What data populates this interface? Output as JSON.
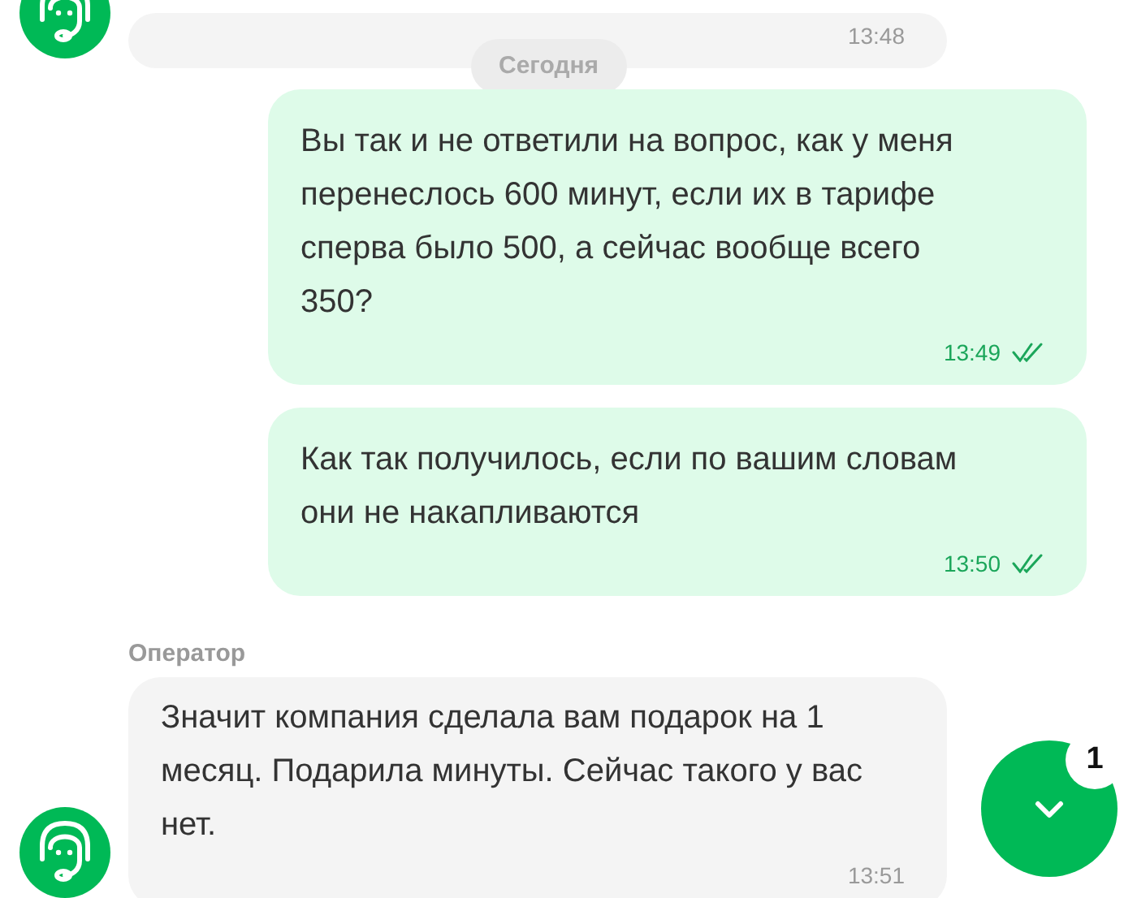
{
  "messages": [
    {
      "kind": "incoming",
      "time": "13:48"
    },
    {
      "kind": "date",
      "text": "Сегодня"
    },
    {
      "kind": "outgoing",
      "text": "Вы так и не ответили на вопрос, как у меня перенеслось 600 минут, если их в тарифе сперва было 500, а сейчас вообще всего 350?",
      "time": "13:49",
      "read": true
    },
    {
      "kind": "outgoing",
      "text": "Как так получилось, если по вашим словам они не накапливаются",
      "time": "13:50",
      "read": true
    },
    {
      "kind": "incoming",
      "sender": "Оператор",
      "text": "Значит компания сделала вам подарок на 1 месяц. Подарила минуты. Сейчас такого у вас нет.",
      "time": "13:51"
    }
  ],
  "scroll_button": {
    "badge": "1"
  }
}
